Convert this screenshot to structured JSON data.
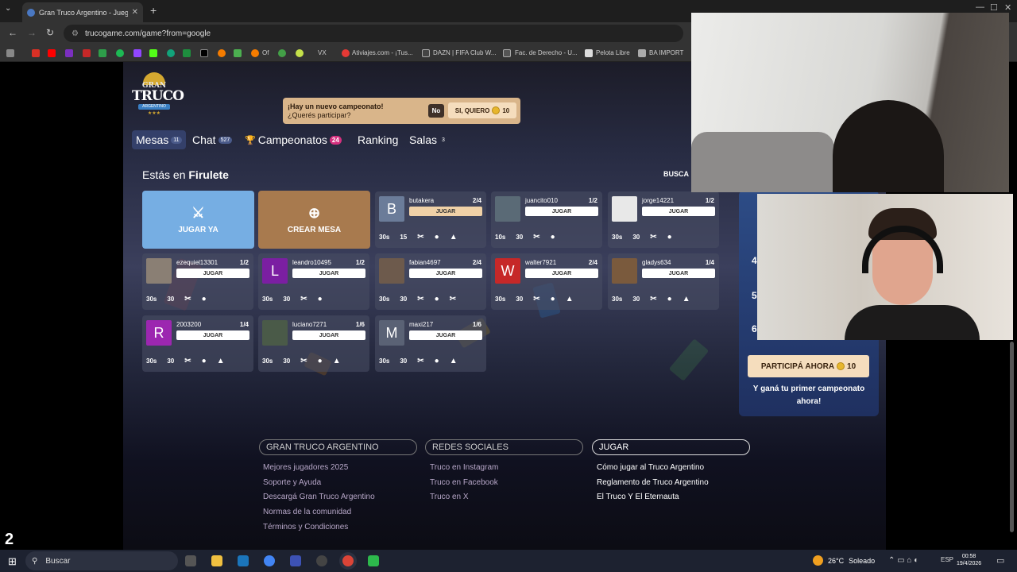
{
  "browser": {
    "tab_title": "Gran Truco Argentino - Juego d",
    "url": "trucogame.com/game?from=google",
    "bookmarks": [
      "Of",
      "VX",
      "Ativiajes.com - ¡Tus...",
      "DAZN | FIFA Club W...",
      "Fac. de Derecho - U...",
      "Pelota Libre",
      "BA IMPORT"
    ]
  },
  "logo": {
    "gran": "GRAN",
    "truco": "TRUCO",
    "argentino": "ARGENTINO"
  },
  "notification": {
    "line1": "¡Hay un nuevo campeonato!",
    "line2": "¿Querés participar?",
    "no_label": "No",
    "yes_label": "SI, QUIERO",
    "yes_coins": "10"
  },
  "nav": {
    "items": [
      {
        "label": "Mesas",
        "badge": "11"
      },
      {
        "label": "Chat",
        "badge": "527"
      },
      {
        "label": "Campeonatos",
        "badge": "24"
      },
      {
        "label": "Ranking",
        "badge": ""
      },
      {
        "label": "Salas",
        "badge": "3"
      }
    ]
  },
  "location": {
    "prefix": "Estás en",
    "name": "Firulete"
  },
  "search_label": "BUSCA",
  "actions": {
    "play_now": "JUGAR YA",
    "create_table": "CREAR MESA"
  },
  "tables": [
    {
      "player": "butakera",
      "count": "2/4",
      "avatar_letter": "B",
      "button": "JUGAR",
      "time": "30s",
      "points": "15"
    },
    {
      "player": "juancito010",
      "count": "1/2",
      "avatar_letter": "",
      "button": "JUGAR",
      "time": "10s",
      "points": "30"
    },
    {
      "player": "jorge14221",
      "count": "1/2",
      "avatar_letter": "",
      "button": "JUGAR",
      "time": "30s",
      "points": "30"
    },
    {
      "player": "ezequiel13301",
      "count": "1/2",
      "avatar_letter": "",
      "button": "JUGAR",
      "time": "30s",
      "points": "30"
    },
    {
      "player": "leandro10495",
      "count": "1/2",
      "avatar_letter": "L",
      "button": "JUGAR",
      "time": "30s",
      "points": "30"
    },
    {
      "player": "fabian4697",
      "count": "2/4",
      "avatar_letter": "",
      "button": "JUGAR",
      "time": "30s",
      "points": "30"
    },
    {
      "player": "walter7921",
      "count": "2/4",
      "avatar_letter": "W",
      "button": "JUGAR",
      "time": "30s",
      "points": "30"
    },
    {
      "player": "gladys634",
      "count": "1/4",
      "avatar_letter": "",
      "button": "JUGAR",
      "time": "30s",
      "points": "30"
    },
    {
      "player": "2003200",
      "count": "1/4",
      "avatar_letter": "R",
      "button": "JUGAR",
      "time": "30s",
      "points": "30"
    },
    {
      "player": "luciano7271",
      "count": "1/6",
      "avatar_letter": "",
      "button": "JUGAR",
      "time": "30s",
      "points": "30"
    },
    {
      "player": "maxi217",
      "count": "1/6",
      "avatar_letter": "M",
      "button": "JUGAR",
      "time": "30s",
      "points": "30"
    }
  ],
  "championship_panel": {
    "ranks": [
      "4",
      "5",
      "6"
    ],
    "button_label": "PARTICIPÁ AHORA",
    "button_coins": "10",
    "text": "Y ganá tu primer campeonato ahora!"
  },
  "footer": {
    "col1": {
      "title": "GRAN TRUCO ARGENTINO",
      "links": [
        "Mejores jugadores 2025",
        "Soporte y Ayuda",
        "Descargá Gran Truco Argentino",
        "Normas de la comunidad",
        "Términos y Condiciones"
      ]
    },
    "col2": {
      "title": "REDES SOCIALES",
      "links": [
        "Truco en Instagram",
        "Truco en Facebook",
        "Truco en X"
      ]
    },
    "col3": {
      "title": "JUGAR",
      "links": [
        "Cómo jugar al Truco Argentino",
        "Reglamento de Truco Argentino",
        "El Truco Y El Eternauta"
      ]
    }
  },
  "overlay_number": "2",
  "taskbar": {
    "search": "Buscar",
    "weather": "26°C",
    "weather_desc": "Soleado",
    "lang": "ESP",
    "time": "00:58",
    "date": "19/4/2026"
  },
  "colors": {
    "accent_blue": "#76aee3",
    "accent_tan": "#a87a4e",
    "badge_pink": "#d6307f",
    "coin": "#e7b62d"
  }
}
